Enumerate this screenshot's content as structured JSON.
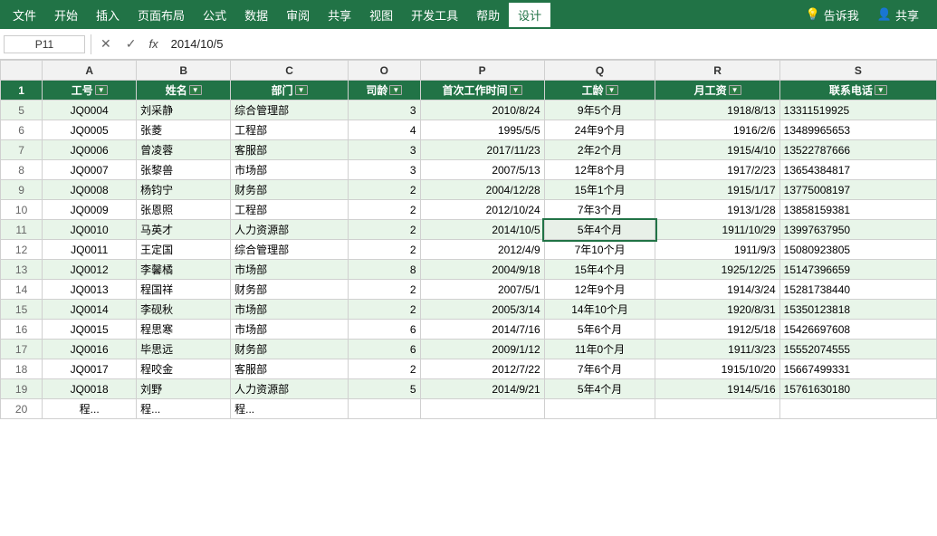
{
  "menu": {
    "items": [
      "文件",
      "开始",
      "插入",
      "页面布局",
      "公式",
      "数据",
      "审阅",
      "共享",
      "视图",
      "开发工具",
      "帮助",
      "设计"
    ],
    "active_item": "设计",
    "right_items": [
      "告诉我",
      "共享"
    ]
  },
  "formula_bar": {
    "cell_ref": "P11",
    "formula_value": "2014/10/5",
    "fx_label": "fx"
  },
  "columns": {
    "headers": [
      "",
      "A",
      "B",
      "C",
      "O",
      "P",
      "Q",
      "R",
      "S"
    ],
    "display_names": [
      "",
      "工号",
      "姓名",
      "部门",
      "司龄",
      "首次工作时间",
      "工龄",
      "月工资",
      "联系电话"
    ]
  },
  "rows": [
    {
      "row_num": "1",
      "type": "header",
      "cols": [
        "工号",
        "姓名",
        "部门",
        "司龄",
        "首次工作时间",
        "工龄",
        "月工资",
        "联系电话"
      ]
    },
    {
      "row_num": "5",
      "type": "odd",
      "cols": [
        "JQ0004",
        "刘采静",
        "综合管理部",
        "3",
        "2010/8/24",
        "9年5个月",
        "1918/8/13",
        "13311519925"
      ]
    },
    {
      "row_num": "6",
      "type": "even",
      "cols": [
        "JQ0005",
        "张菱",
        "工程部",
        "4",
        "1995/5/5",
        "24年9个月",
        "1916/2/6",
        "13489965653"
      ]
    },
    {
      "row_num": "7",
      "type": "odd",
      "cols": [
        "JQ0006",
        "曾凌蓉",
        "客服部",
        "3",
        "2017/11/23",
        "2年2个月",
        "1915/4/10",
        "13522787666"
      ]
    },
    {
      "row_num": "8",
      "type": "even",
      "cols": [
        "JQ0007",
        "张黎兽",
        "市场部",
        "3",
        "2007/5/13",
        "12年8个月",
        "1917/2/23",
        "13654384817"
      ]
    },
    {
      "row_num": "9",
      "type": "odd",
      "cols": [
        "JQ0008",
        "杨钧宁",
        "财务部",
        "2",
        "2004/12/28",
        "15年1个月",
        "1915/1/17",
        "13775008197"
      ]
    },
    {
      "row_num": "10",
      "type": "even",
      "cols": [
        "JQ0009",
        "张恩照",
        "工程部",
        "2",
        "2012/10/24",
        "7年3个月",
        "1913/1/28",
        "13858159381"
      ]
    },
    {
      "row_num": "11",
      "type": "odd",
      "cols": [
        "JQ0010",
        "马英才",
        "人力资源部",
        "2",
        "2014/10/5",
        "5年4个月",
        "1911/10/29",
        "13997637950"
      ]
    },
    {
      "row_num": "12",
      "type": "even",
      "cols": [
        "JQ0011",
        "王定国",
        "综合管理部",
        "2",
        "2012/4/9",
        "7年10个月",
        "1911/9/3",
        "15080923805"
      ]
    },
    {
      "row_num": "13",
      "type": "odd",
      "cols": [
        "JQ0012",
        "李馨橘",
        "市场部",
        "8",
        "2004/9/18",
        "15年4个月",
        "1925/12/25",
        "15147396659"
      ]
    },
    {
      "row_num": "14",
      "type": "even",
      "cols": [
        "JQ0013",
        "程国祥",
        "财务部",
        "2",
        "2007/5/1",
        "12年9个月",
        "1914/3/24",
        "15281738440"
      ]
    },
    {
      "row_num": "15",
      "type": "odd",
      "cols": [
        "JQ0014",
        "李砚秋",
        "市场部",
        "2",
        "2005/3/14",
        "14年10个月",
        "1920/8/31",
        "15350123818"
      ]
    },
    {
      "row_num": "16",
      "type": "even",
      "cols": [
        "JQ0015",
        "程思寒",
        "市场部",
        "6",
        "2014/7/16",
        "5年6个月",
        "1912/5/18",
        "15426697608"
      ]
    },
    {
      "row_num": "17",
      "type": "odd",
      "cols": [
        "JQ0016",
        "毕思远",
        "财务部",
        "6",
        "2009/1/12",
        "11年0个月",
        "1911/3/23",
        "15552074555"
      ]
    },
    {
      "row_num": "18",
      "type": "even",
      "cols": [
        "JQ0017",
        "程咬金",
        "客服部",
        "2",
        "2012/7/22",
        "7年6个月",
        "1915/10/20",
        "15667499331"
      ]
    },
    {
      "row_num": "19",
      "type": "odd",
      "cols": [
        "JQ0018",
        "刘野",
        "人力资源部",
        "5",
        "2014/9/21",
        "5年4个月",
        "1914/5/16",
        "15761630180"
      ]
    },
    {
      "row_num": "20",
      "type": "even",
      "cols": [
        "程...",
        "程...",
        "程...",
        "",
        "",
        "",
        "",
        ""
      ]
    }
  ]
}
